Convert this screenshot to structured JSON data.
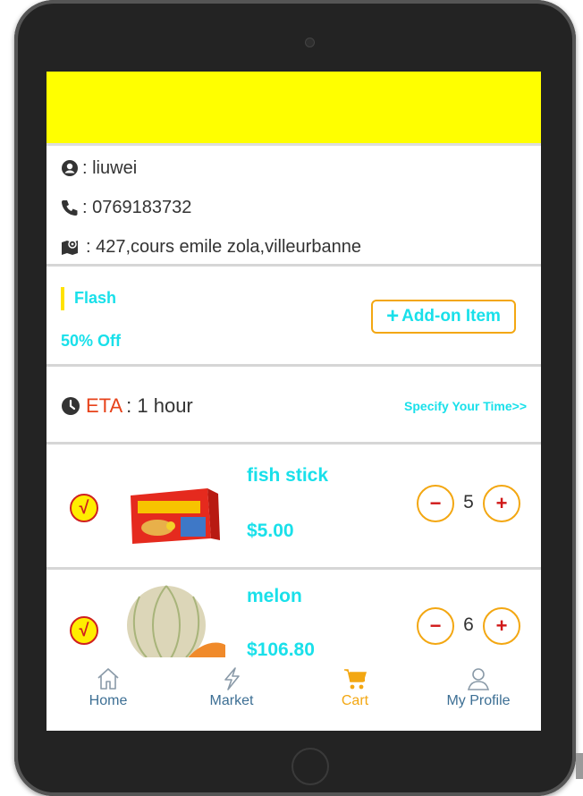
{
  "user": {
    "name_line": ": liuwei",
    "phone_line": ": 0769183732",
    "address_line": ": 427,cours emile zola,villeurbanne"
  },
  "promo": {
    "tag": "Flash",
    "discount": "50% Off",
    "add_on_label": "Add-on Item"
  },
  "eta": {
    "label": "ETA",
    "value": ": 1 hour",
    "specify_link": "Specify Your Time>>"
  },
  "cart_items": [
    {
      "check_mark": "√",
      "name": "fish stick",
      "price": "$5.00",
      "quantity": "5",
      "minus": "−",
      "plus": "+"
    },
    {
      "check_mark": "√",
      "name": "melon",
      "price": "$106.80",
      "quantity": "6",
      "minus": "−",
      "plus": "+"
    }
  ],
  "tabs": [
    {
      "label": "Home",
      "icon": "home-icon"
    },
    {
      "label": "Market",
      "icon": "bolt-icon"
    },
    {
      "label": "Cart",
      "icon": "cart-icon",
      "active": true
    },
    {
      "label": "My Profile",
      "icon": "user-icon"
    }
  ],
  "colors": {
    "accent": "#19e0ea",
    "orange": "#f3a712",
    "banner": "#ffff00",
    "eta_label": "#e7421a",
    "tab_default": "#3d6f94"
  }
}
